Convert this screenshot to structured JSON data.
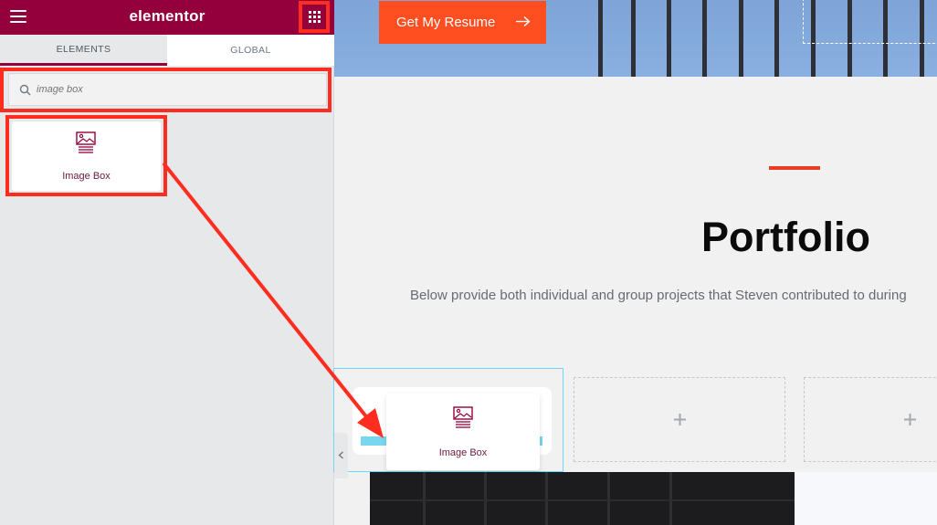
{
  "panel": {
    "logo": "elementor",
    "brand_color": "#93003c",
    "menu_icon": "hamburger-menu-icon",
    "apps_icon": "grid-apps-icon",
    "tabs": [
      {
        "label": "ELEMENTS",
        "active": true
      },
      {
        "label": "GLOBAL",
        "active": false
      }
    ],
    "search": {
      "value": "",
      "placeholder": "image box",
      "icon": "search-icon"
    },
    "widgets": [
      {
        "label": "Image Box",
        "icon": "image-box-icon"
      }
    ]
  },
  "canvas": {
    "hero_button": {
      "label": "Get My Resume",
      "icon": "arrow-right-icon",
      "color": "#ff4e1f"
    },
    "section": {
      "title": "Portfolio",
      "description": "Below provide both individual and group projects that Steven contributed to during",
      "accent_color": "#ea3d23"
    },
    "drag_preview": {
      "label": "Image Box",
      "icon": "image-box-icon"
    },
    "empty_column_icon": "plus-icon"
  },
  "annotations": {
    "color": "#ff2d20",
    "arrow": "drag-arrow"
  }
}
